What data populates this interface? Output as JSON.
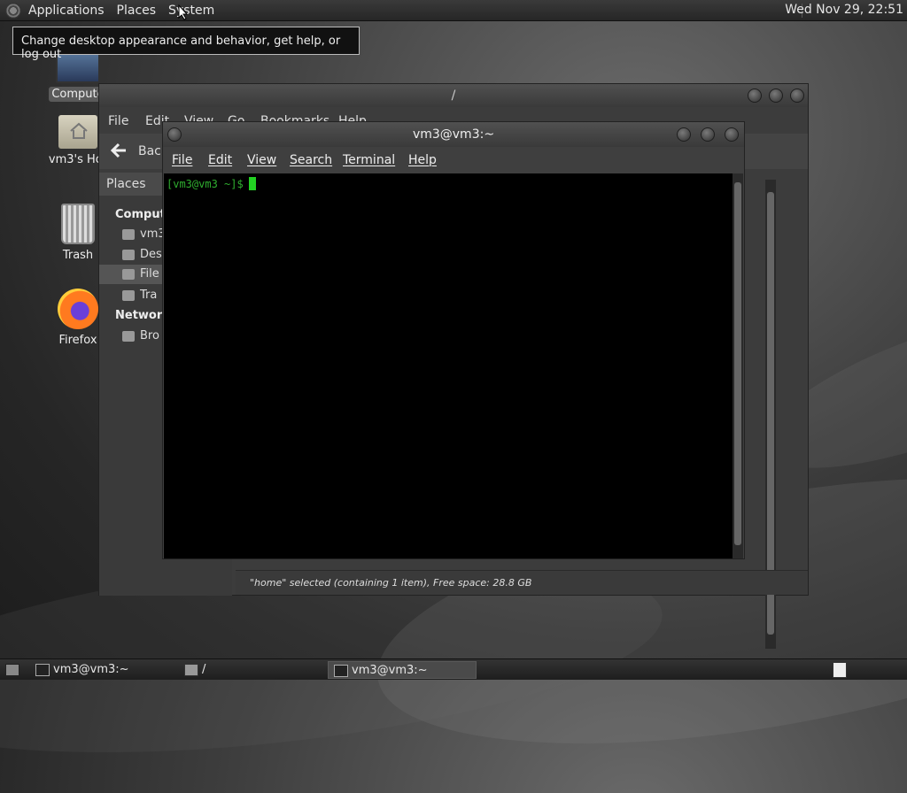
{
  "top_panel": {
    "menus": [
      "Applications",
      "Places",
      "System"
    ],
    "clock": "Wed Nov 29, 22:51"
  },
  "tooltip": "Change desktop appearance and behavior, get help, or log out",
  "desktop_icons": {
    "computer": "Compute",
    "home": "vm3's Hor",
    "trash": "Trash",
    "firefox": "Firefox"
  },
  "caja": {
    "title": "/",
    "menus": [
      "File",
      "Edit",
      "View",
      "Go",
      "Bookmarks",
      "Help"
    ],
    "back_label": "Back",
    "places_label": "Places",
    "sidebar": {
      "computer_section": "Compute",
      "items": [
        "vm3",
        "Des",
        "File",
        "Tra"
      ],
      "network_section": "Network",
      "network_items": [
        "Bro"
      ]
    },
    "status": "\"home\" selected (containing 1 item), Free space: 28.8 GB"
  },
  "terminal": {
    "title": "vm3@vm3:~",
    "menus": [
      "File",
      "Edit",
      "View",
      "Search",
      "Terminal",
      "Help"
    ],
    "prompt": "[vm3@vm3 ~]$"
  },
  "taskbar": {
    "tasks": [
      "vm3@vm3:~",
      "/",
      "vm3@vm3:~"
    ]
  },
  "colors": {
    "prompt_green": "#2fae2f",
    "cursor_green": "#22d122"
  }
}
